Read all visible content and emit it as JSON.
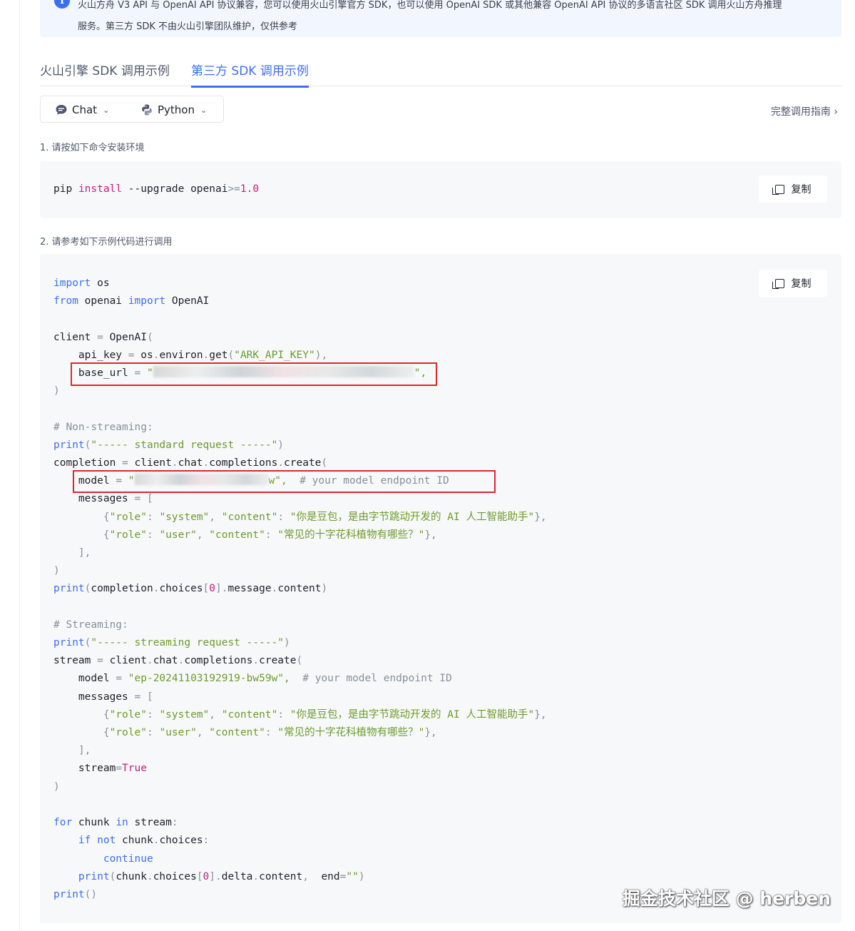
{
  "notice": {
    "line1": "火山方舟 V3 API 与 OpenAI API 协议兼容，您可以使用火山引擎官方 SDK，也可以使用 OpenAI SDK 或其他兼容 OpenAI API 协议的多语言社区 SDK 调用火山方舟推理",
    "line2": "服务。第三方 SDK 不由火山引擎团队维护，仅供参考"
  },
  "tabs": [
    {
      "label": "火山引擎 SDK 调用示例",
      "active": false
    },
    {
      "label": "第三方 SDK 调用示例",
      "active": true
    }
  ],
  "selectors": {
    "api": "Chat",
    "language": "Python"
  },
  "guide_link": "完整调用指南",
  "steps": {
    "step1": "1. 请按如下命令安装环境",
    "step2": "2. 请参考如下示例代码进行调用"
  },
  "copy_label": "复制",
  "install_cmd": {
    "pip": "pip",
    "install": "install",
    "args": " --upgrade openai",
    "op": ">=",
    "version": "1.0"
  },
  "code": {
    "import_os": "os",
    "from_mod": "openai",
    "import_cls": "OpenAI",
    "api_key_env": "ARK_API_KEY",
    "comment_non_stream": "# Non-streaming:",
    "standard_request": "\"----- standard request -----\"",
    "model_comment": "# your model endpoint ID",
    "system_content": "\"你是豆包，是由字节跳动开发的 AI 人工智能助手\"",
    "user_content": "\"常见的十字花科植物有哪些？\"",
    "comment_stream": "# Streaming:",
    "streaming_request": "\"----- streaming request -----\"",
    "model_id": "\"ep-20241103192919-bw59w\"",
    "stream_true": "True"
  },
  "watermark": "掘金技术社区 @ herben",
  "colors": {
    "accent": "#3a6ff5",
    "highlight_box": "#e0262d",
    "string": "#6c9c2b",
    "code_bg": "#f7f8fa"
  }
}
